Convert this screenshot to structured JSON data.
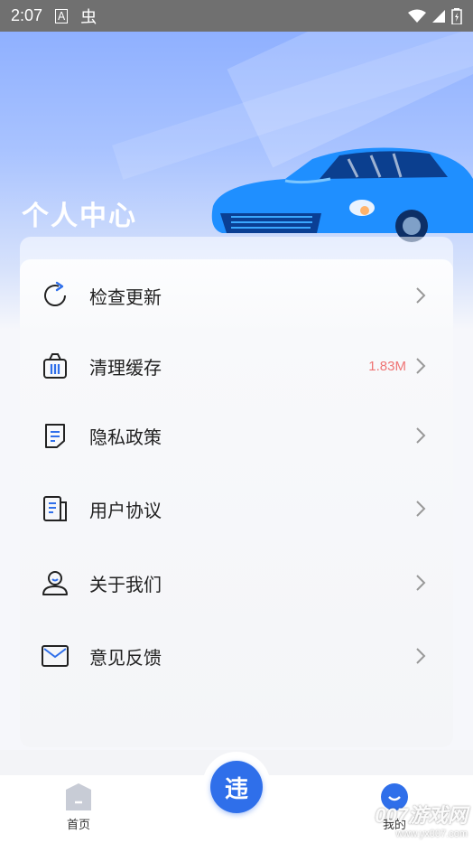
{
  "status_bar": {
    "time": "2:07",
    "notif_icon_1": "A",
    "notif_icon_2": "虫"
  },
  "header": {
    "title": "个人中心"
  },
  "menu": {
    "items": [
      {
        "label": "检查更新",
        "value": "",
        "icon": "refresh-icon"
      },
      {
        "label": "清理缓存",
        "value": "1.83M",
        "icon": "trash-basket-icon"
      },
      {
        "label": "隐私政策",
        "value": "",
        "icon": "document-icon"
      },
      {
        "label": "用户协议",
        "value": "",
        "icon": "agreement-icon"
      },
      {
        "label": "关于我们",
        "value": "",
        "icon": "user-icon"
      },
      {
        "label": "意见反馈",
        "value": "",
        "icon": "mail-icon"
      }
    ]
  },
  "bottom_nav": {
    "home_label": "首页",
    "center_glyph": "违",
    "mine_label": "我的"
  },
  "watermark": {
    "line1": "007游戏网",
    "line2": "www.yx007.com"
  },
  "colors": {
    "accent": "#2f6fea",
    "value_red": "#ef7474",
    "hero_blue": "#8fb0ff"
  }
}
